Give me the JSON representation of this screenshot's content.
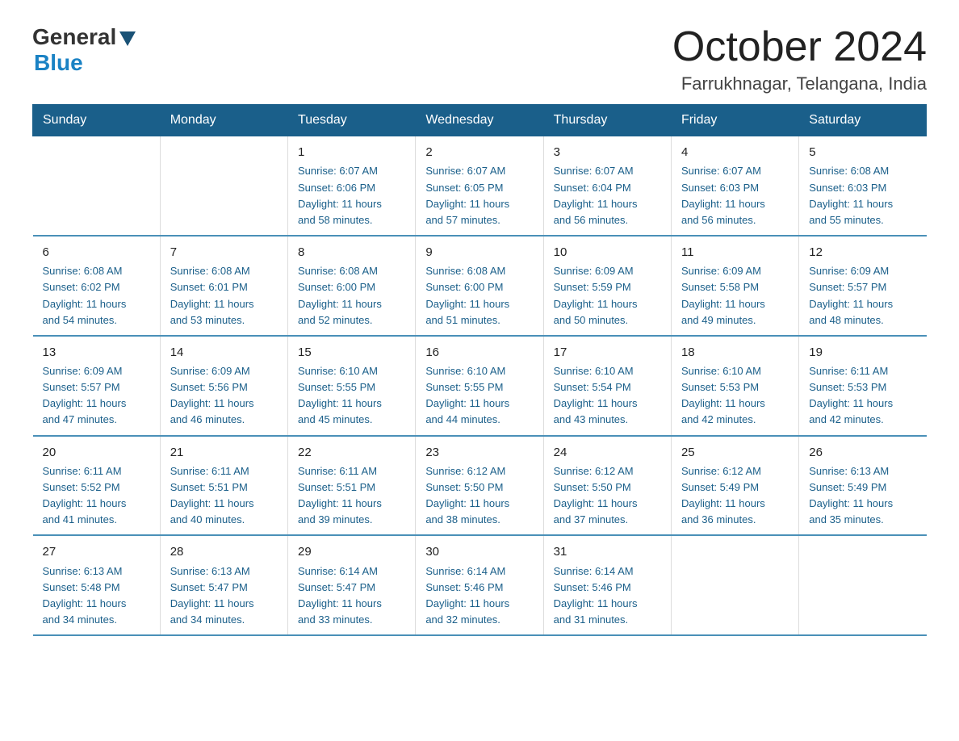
{
  "logo": {
    "general": "General",
    "blue": "Blue"
  },
  "title": "October 2024",
  "subtitle": "Farrukhnagar, Telangana, India",
  "days_of_week": [
    "Sunday",
    "Monday",
    "Tuesday",
    "Wednesday",
    "Thursday",
    "Friday",
    "Saturday"
  ],
  "weeks": [
    [
      {
        "day": "",
        "info": ""
      },
      {
        "day": "",
        "info": ""
      },
      {
        "day": "1",
        "info": "Sunrise: 6:07 AM\nSunset: 6:06 PM\nDaylight: 11 hours\nand 58 minutes."
      },
      {
        "day": "2",
        "info": "Sunrise: 6:07 AM\nSunset: 6:05 PM\nDaylight: 11 hours\nand 57 minutes."
      },
      {
        "day": "3",
        "info": "Sunrise: 6:07 AM\nSunset: 6:04 PM\nDaylight: 11 hours\nand 56 minutes."
      },
      {
        "day": "4",
        "info": "Sunrise: 6:07 AM\nSunset: 6:03 PM\nDaylight: 11 hours\nand 56 minutes."
      },
      {
        "day": "5",
        "info": "Sunrise: 6:08 AM\nSunset: 6:03 PM\nDaylight: 11 hours\nand 55 minutes."
      }
    ],
    [
      {
        "day": "6",
        "info": "Sunrise: 6:08 AM\nSunset: 6:02 PM\nDaylight: 11 hours\nand 54 minutes."
      },
      {
        "day": "7",
        "info": "Sunrise: 6:08 AM\nSunset: 6:01 PM\nDaylight: 11 hours\nand 53 minutes."
      },
      {
        "day": "8",
        "info": "Sunrise: 6:08 AM\nSunset: 6:00 PM\nDaylight: 11 hours\nand 52 minutes."
      },
      {
        "day": "9",
        "info": "Sunrise: 6:08 AM\nSunset: 6:00 PM\nDaylight: 11 hours\nand 51 minutes."
      },
      {
        "day": "10",
        "info": "Sunrise: 6:09 AM\nSunset: 5:59 PM\nDaylight: 11 hours\nand 50 minutes."
      },
      {
        "day": "11",
        "info": "Sunrise: 6:09 AM\nSunset: 5:58 PM\nDaylight: 11 hours\nand 49 minutes."
      },
      {
        "day": "12",
        "info": "Sunrise: 6:09 AM\nSunset: 5:57 PM\nDaylight: 11 hours\nand 48 minutes."
      }
    ],
    [
      {
        "day": "13",
        "info": "Sunrise: 6:09 AM\nSunset: 5:57 PM\nDaylight: 11 hours\nand 47 minutes."
      },
      {
        "day": "14",
        "info": "Sunrise: 6:09 AM\nSunset: 5:56 PM\nDaylight: 11 hours\nand 46 minutes."
      },
      {
        "day": "15",
        "info": "Sunrise: 6:10 AM\nSunset: 5:55 PM\nDaylight: 11 hours\nand 45 minutes."
      },
      {
        "day": "16",
        "info": "Sunrise: 6:10 AM\nSunset: 5:55 PM\nDaylight: 11 hours\nand 44 minutes."
      },
      {
        "day": "17",
        "info": "Sunrise: 6:10 AM\nSunset: 5:54 PM\nDaylight: 11 hours\nand 43 minutes."
      },
      {
        "day": "18",
        "info": "Sunrise: 6:10 AM\nSunset: 5:53 PM\nDaylight: 11 hours\nand 42 minutes."
      },
      {
        "day": "19",
        "info": "Sunrise: 6:11 AM\nSunset: 5:53 PM\nDaylight: 11 hours\nand 42 minutes."
      }
    ],
    [
      {
        "day": "20",
        "info": "Sunrise: 6:11 AM\nSunset: 5:52 PM\nDaylight: 11 hours\nand 41 minutes."
      },
      {
        "day": "21",
        "info": "Sunrise: 6:11 AM\nSunset: 5:51 PM\nDaylight: 11 hours\nand 40 minutes."
      },
      {
        "day": "22",
        "info": "Sunrise: 6:11 AM\nSunset: 5:51 PM\nDaylight: 11 hours\nand 39 minutes."
      },
      {
        "day": "23",
        "info": "Sunrise: 6:12 AM\nSunset: 5:50 PM\nDaylight: 11 hours\nand 38 minutes."
      },
      {
        "day": "24",
        "info": "Sunrise: 6:12 AM\nSunset: 5:50 PM\nDaylight: 11 hours\nand 37 minutes."
      },
      {
        "day": "25",
        "info": "Sunrise: 6:12 AM\nSunset: 5:49 PM\nDaylight: 11 hours\nand 36 minutes."
      },
      {
        "day": "26",
        "info": "Sunrise: 6:13 AM\nSunset: 5:49 PM\nDaylight: 11 hours\nand 35 minutes."
      }
    ],
    [
      {
        "day": "27",
        "info": "Sunrise: 6:13 AM\nSunset: 5:48 PM\nDaylight: 11 hours\nand 34 minutes."
      },
      {
        "day": "28",
        "info": "Sunrise: 6:13 AM\nSunset: 5:47 PM\nDaylight: 11 hours\nand 34 minutes."
      },
      {
        "day": "29",
        "info": "Sunrise: 6:14 AM\nSunset: 5:47 PM\nDaylight: 11 hours\nand 33 minutes."
      },
      {
        "day": "30",
        "info": "Sunrise: 6:14 AM\nSunset: 5:46 PM\nDaylight: 11 hours\nand 32 minutes."
      },
      {
        "day": "31",
        "info": "Sunrise: 6:14 AM\nSunset: 5:46 PM\nDaylight: 11 hours\nand 31 minutes."
      },
      {
        "day": "",
        "info": ""
      },
      {
        "day": "",
        "info": ""
      }
    ]
  ]
}
